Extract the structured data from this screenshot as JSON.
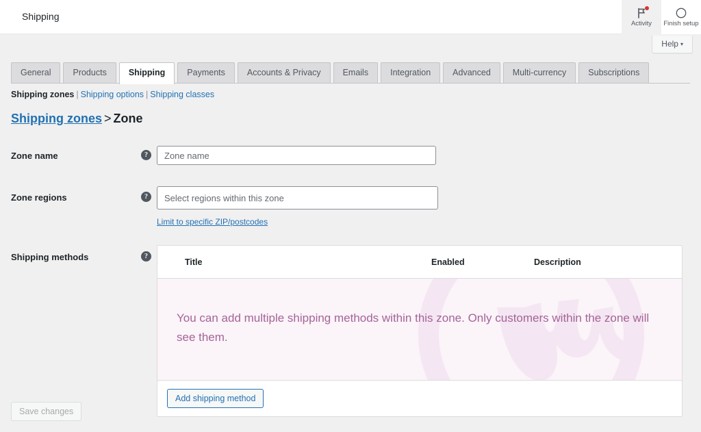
{
  "header": {
    "title": "Shipping",
    "actions": [
      {
        "label": "Activity",
        "icon": "flag-icon",
        "has_notification": true
      },
      {
        "label": "Finish setup",
        "icon": "circle-progress-icon",
        "has_notification": false
      }
    ],
    "help_button": {
      "label": "Help",
      "caret": "▾"
    }
  },
  "tabs": [
    {
      "label": "General",
      "active": false
    },
    {
      "label": "Products",
      "active": false
    },
    {
      "label": "Shipping",
      "active": true
    },
    {
      "label": "Payments",
      "active": false
    },
    {
      "label": "Accounts & Privacy",
      "active": false
    },
    {
      "label": "Emails",
      "active": false
    },
    {
      "label": "Integration",
      "active": false
    },
    {
      "label": "Advanced",
      "active": false
    },
    {
      "label": "Multi-currency",
      "active": false
    },
    {
      "label": "Subscriptions",
      "active": false
    }
  ],
  "subnav": {
    "items": [
      {
        "label": "Shipping zones",
        "current": true
      },
      {
        "label": "Shipping options",
        "current": false
      },
      {
        "label": "Shipping classes",
        "current": false
      }
    ],
    "separator": "|"
  },
  "breadcrumb": {
    "link": "Shipping zones",
    "separator": ">",
    "current": "Zone"
  },
  "form": {
    "zone_name": {
      "label": "Zone name",
      "help": "?",
      "value": "",
      "placeholder": "Zone name"
    },
    "zone_regions": {
      "label": "Zone regions",
      "help": "?",
      "value": "",
      "placeholder": "Select regions within this zone"
    },
    "zip_link": "Limit to specific ZIP/postcodes",
    "shipping_methods": {
      "label": "Shipping methods",
      "help": "?",
      "columns": [
        "",
        "Title",
        "Enabled",
        "Description"
      ],
      "empty_message": "You can add multiple shipping methods within this zone. Only customers within the zone will see them.",
      "add_button": "Add shipping method"
    }
  },
  "footer": {
    "save_button": "Save changes",
    "save_disabled": true
  },
  "colors": {
    "page_bg": "#f0f0f1",
    "link": "#2271b1",
    "accent_pink_bg": "#fbf4f9",
    "accent_pink_text": "#a46497",
    "notification": "#d63638",
    "tab_inactive_bg": "#dcdcde"
  }
}
